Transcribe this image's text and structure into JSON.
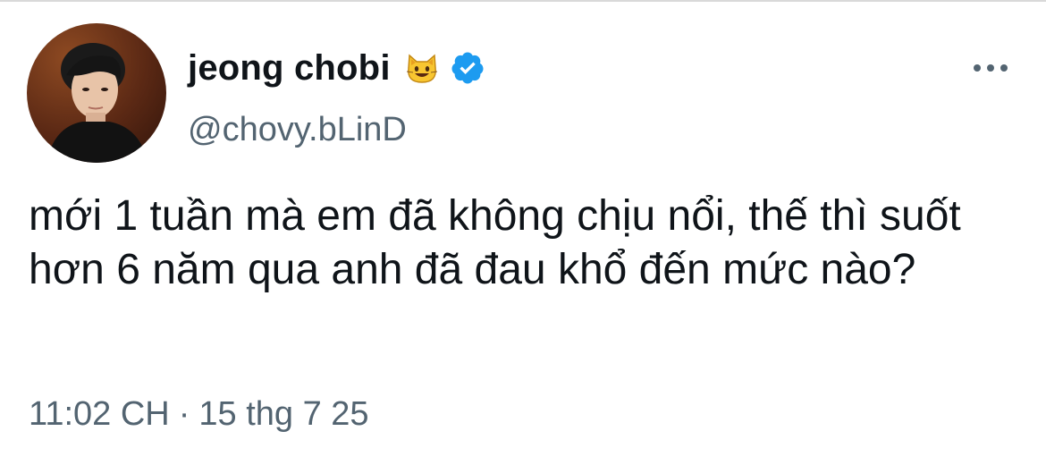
{
  "author": {
    "display_name": "jeong chobi",
    "handle": "@chovy.bLinD",
    "emoji_icon": "smiling-cat-emoji",
    "verified_icon": "verified-badge-icon"
  },
  "tweet": {
    "text": "mới 1 tuần mà em đã không chịu nổi, thế thì suốt hơn 6 năm qua anh đã đau khổ đến mức nào?",
    "time": "11:02 CH",
    "separator": "·",
    "date": "15 thg 7 25"
  },
  "actions": {
    "more_icon": "more-options-icon"
  },
  "colors": {
    "text": "#0f1419",
    "secondary": "#536471",
    "verified": "#1d9bf0"
  }
}
